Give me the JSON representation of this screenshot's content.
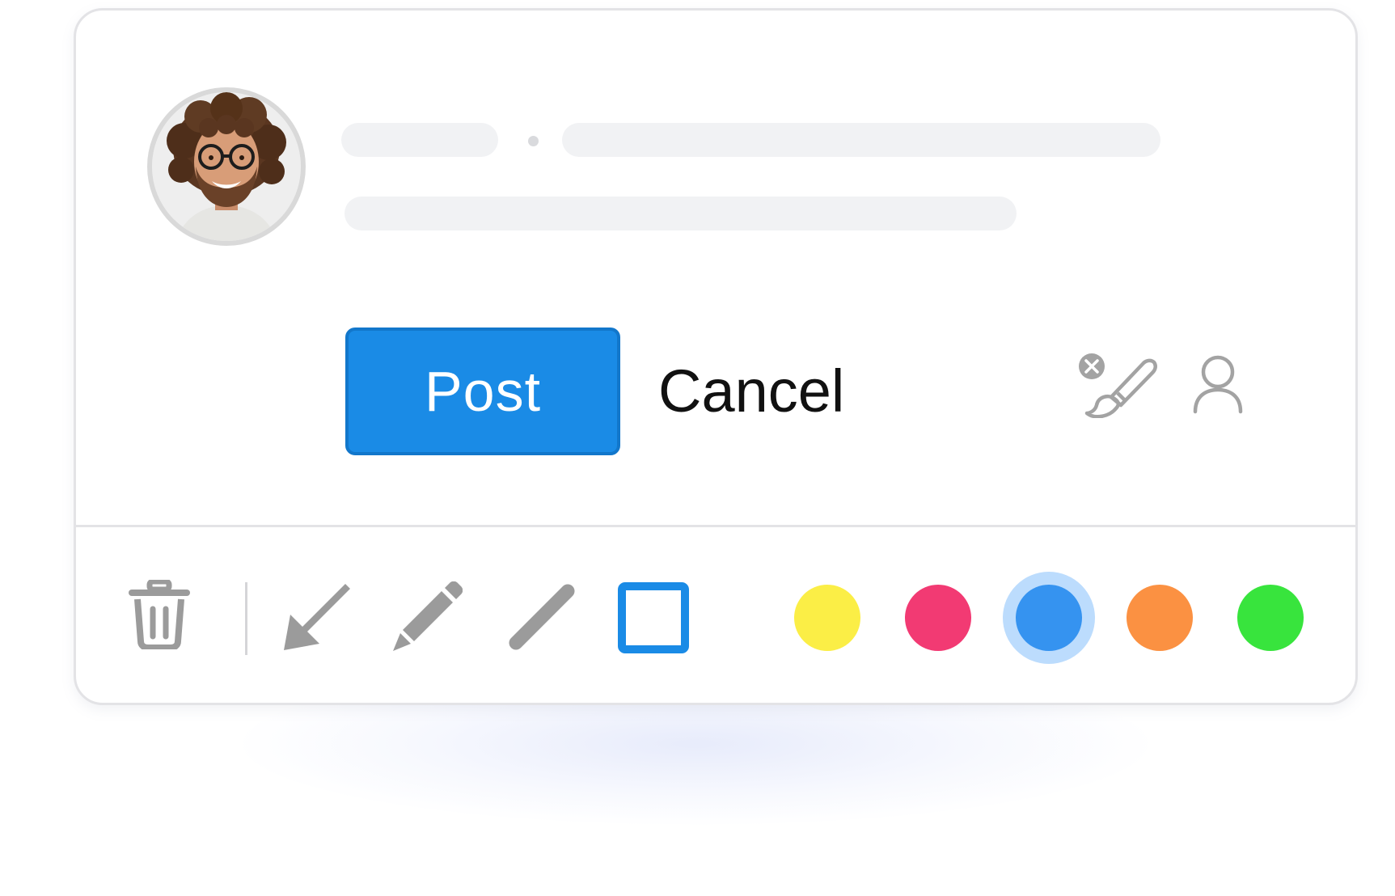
{
  "composer": {
    "post_label": "Post",
    "cancel_label": "Cancel"
  },
  "icons": {
    "clear_annotations": "paintbrush-clear-icon",
    "mention": "user-icon"
  },
  "toolbar": {
    "tools": [
      "trash-icon",
      "arrow-icon",
      "pencil-icon",
      "line-icon",
      "rectangle-icon"
    ],
    "active_tool": "rectangle",
    "colors": [
      {
        "name": "yellow",
        "hex": "#fbee46"
      },
      {
        "name": "pink",
        "hex": "#f23a73"
      },
      {
        "name": "blue",
        "hex": "#3593f0"
      },
      {
        "name": "orange",
        "hex": "#fb9142"
      },
      {
        "name": "green",
        "hex": "#38e43d"
      }
    ],
    "selected_color": "blue",
    "accent": "#1a8be6"
  }
}
